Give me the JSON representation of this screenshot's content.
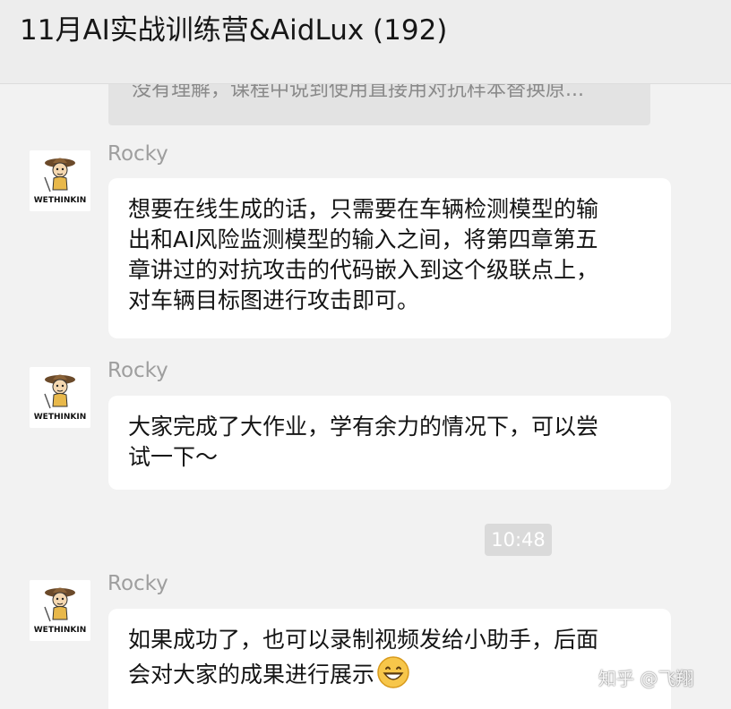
{
  "header": {
    "title": "11月AI实战训练营&AidLux (192)"
  },
  "quoted_message": {
    "text": "没有理解，课程中说到使用直接用对抗样本替换原..."
  },
  "messages": [
    {
      "sender": "Rocky",
      "avatar_text": "WETHINKIN",
      "lines": [
        "想要在线生成的话，只需要在车辆检测模型的输",
        "出和AI风险监测模型的输入之间，将第四章第五",
        "章讲过的对抗攻击的代码嵌入到这个级联点上，",
        "对车辆目标图进行攻击即可。"
      ]
    },
    {
      "sender": "Rocky",
      "avatar_text": "WETHINKIN",
      "lines": [
        "大家完成了大作业，学有余力的情况下，可以尝",
        "试一下～"
      ]
    },
    {
      "sender": "Rocky",
      "avatar_text": "WETHINKIN",
      "lines": [
        "如果成功了，也可以录制视频发给小助手，后面",
        "会对大家的成果进行展示"
      ],
      "trailing_emoji": "grinning-face-emoji"
    }
  ],
  "timestamp": "10:48",
  "watermark": "知乎 @飞翔",
  "colors": {
    "background": "#f2f2f2",
    "header": "#ededed",
    "bubble": "#ffffff",
    "sender_name": "#9e9e9e",
    "timestamp_bg": "#dadada"
  }
}
